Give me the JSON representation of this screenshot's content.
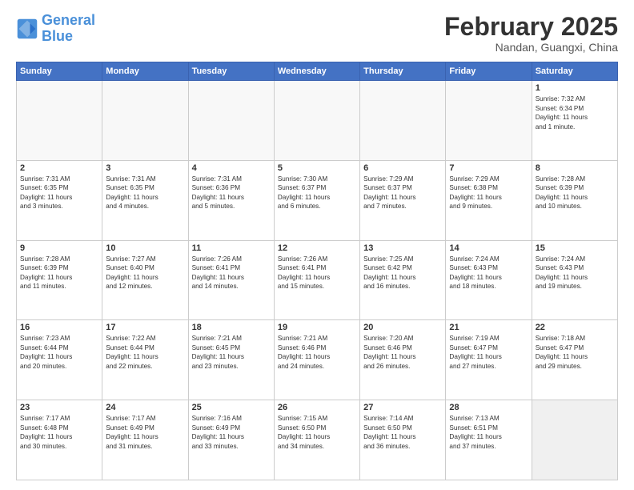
{
  "header": {
    "logo": {
      "line1": "General",
      "line2": "Blue"
    },
    "title": "February 2025",
    "location": "Nandan, Guangxi, China"
  },
  "weekdays": [
    "Sunday",
    "Monday",
    "Tuesday",
    "Wednesday",
    "Thursday",
    "Friday",
    "Saturday"
  ],
  "weeks": [
    [
      {
        "day": "",
        "info": ""
      },
      {
        "day": "",
        "info": ""
      },
      {
        "day": "",
        "info": ""
      },
      {
        "day": "",
        "info": ""
      },
      {
        "day": "",
        "info": ""
      },
      {
        "day": "",
        "info": ""
      },
      {
        "day": "1",
        "info": "Sunrise: 7:32 AM\nSunset: 6:34 PM\nDaylight: 11 hours\nand 1 minute."
      }
    ],
    [
      {
        "day": "2",
        "info": "Sunrise: 7:31 AM\nSunset: 6:35 PM\nDaylight: 11 hours\nand 3 minutes."
      },
      {
        "day": "3",
        "info": "Sunrise: 7:31 AM\nSunset: 6:35 PM\nDaylight: 11 hours\nand 4 minutes."
      },
      {
        "day": "4",
        "info": "Sunrise: 7:31 AM\nSunset: 6:36 PM\nDaylight: 11 hours\nand 5 minutes."
      },
      {
        "day": "5",
        "info": "Sunrise: 7:30 AM\nSunset: 6:37 PM\nDaylight: 11 hours\nand 6 minutes."
      },
      {
        "day": "6",
        "info": "Sunrise: 7:29 AM\nSunset: 6:37 PM\nDaylight: 11 hours\nand 7 minutes."
      },
      {
        "day": "7",
        "info": "Sunrise: 7:29 AM\nSunset: 6:38 PM\nDaylight: 11 hours\nand 9 minutes."
      },
      {
        "day": "8",
        "info": "Sunrise: 7:28 AM\nSunset: 6:39 PM\nDaylight: 11 hours\nand 10 minutes."
      }
    ],
    [
      {
        "day": "9",
        "info": "Sunrise: 7:28 AM\nSunset: 6:39 PM\nDaylight: 11 hours\nand 11 minutes."
      },
      {
        "day": "10",
        "info": "Sunrise: 7:27 AM\nSunset: 6:40 PM\nDaylight: 11 hours\nand 12 minutes."
      },
      {
        "day": "11",
        "info": "Sunrise: 7:26 AM\nSunset: 6:41 PM\nDaylight: 11 hours\nand 14 minutes."
      },
      {
        "day": "12",
        "info": "Sunrise: 7:26 AM\nSunset: 6:41 PM\nDaylight: 11 hours\nand 15 minutes."
      },
      {
        "day": "13",
        "info": "Sunrise: 7:25 AM\nSunset: 6:42 PM\nDaylight: 11 hours\nand 16 minutes."
      },
      {
        "day": "14",
        "info": "Sunrise: 7:24 AM\nSunset: 6:43 PM\nDaylight: 11 hours\nand 18 minutes."
      },
      {
        "day": "15",
        "info": "Sunrise: 7:24 AM\nSunset: 6:43 PM\nDaylight: 11 hours\nand 19 minutes."
      }
    ],
    [
      {
        "day": "16",
        "info": "Sunrise: 7:23 AM\nSunset: 6:44 PM\nDaylight: 11 hours\nand 20 minutes."
      },
      {
        "day": "17",
        "info": "Sunrise: 7:22 AM\nSunset: 6:44 PM\nDaylight: 11 hours\nand 22 minutes."
      },
      {
        "day": "18",
        "info": "Sunrise: 7:21 AM\nSunset: 6:45 PM\nDaylight: 11 hours\nand 23 minutes."
      },
      {
        "day": "19",
        "info": "Sunrise: 7:21 AM\nSunset: 6:46 PM\nDaylight: 11 hours\nand 24 minutes."
      },
      {
        "day": "20",
        "info": "Sunrise: 7:20 AM\nSunset: 6:46 PM\nDaylight: 11 hours\nand 26 minutes."
      },
      {
        "day": "21",
        "info": "Sunrise: 7:19 AM\nSunset: 6:47 PM\nDaylight: 11 hours\nand 27 minutes."
      },
      {
        "day": "22",
        "info": "Sunrise: 7:18 AM\nSunset: 6:47 PM\nDaylight: 11 hours\nand 29 minutes."
      }
    ],
    [
      {
        "day": "23",
        "info": "Sunrise: 7:17 AM\nSunset: 6:48 PM\nDaylight: 11 hours\nand 30 minutes."
      },
      {
        "day": "24",
        "info": "Sunrise: 7:17 AM\nSunset: 6:49 PM\nDaylight: 11 hours\nand 31 minutes."
      },
      {
        "day": "25",
        "info": "Sunrise: 7:16 AM\nSunset: 6:49 PM\nDaylight: 11 hours\nand 33 minutes."
      },
      {
        "day": "26",
        "info": "Sunrise: 7:15 AM\nSunset: 6:50 PM\nDaylight: 11 hours\nand 34 minutes."
      },
      {
        "day": "27",
        "info": "Sunrise: 7:14 AM\nSunset: 6:50 PM\nDaylight: 11 hours\nand 36 minutes."
      },
      {
        "day": "28",
        "info": "Sunrise: 7:13 AM\nSunset: 6:51 PM\nDaylight: 11 hours\nand 37 minutes."
      },
      {
        "day": "",
        "info": ""
      }
    ]
  ]
}
